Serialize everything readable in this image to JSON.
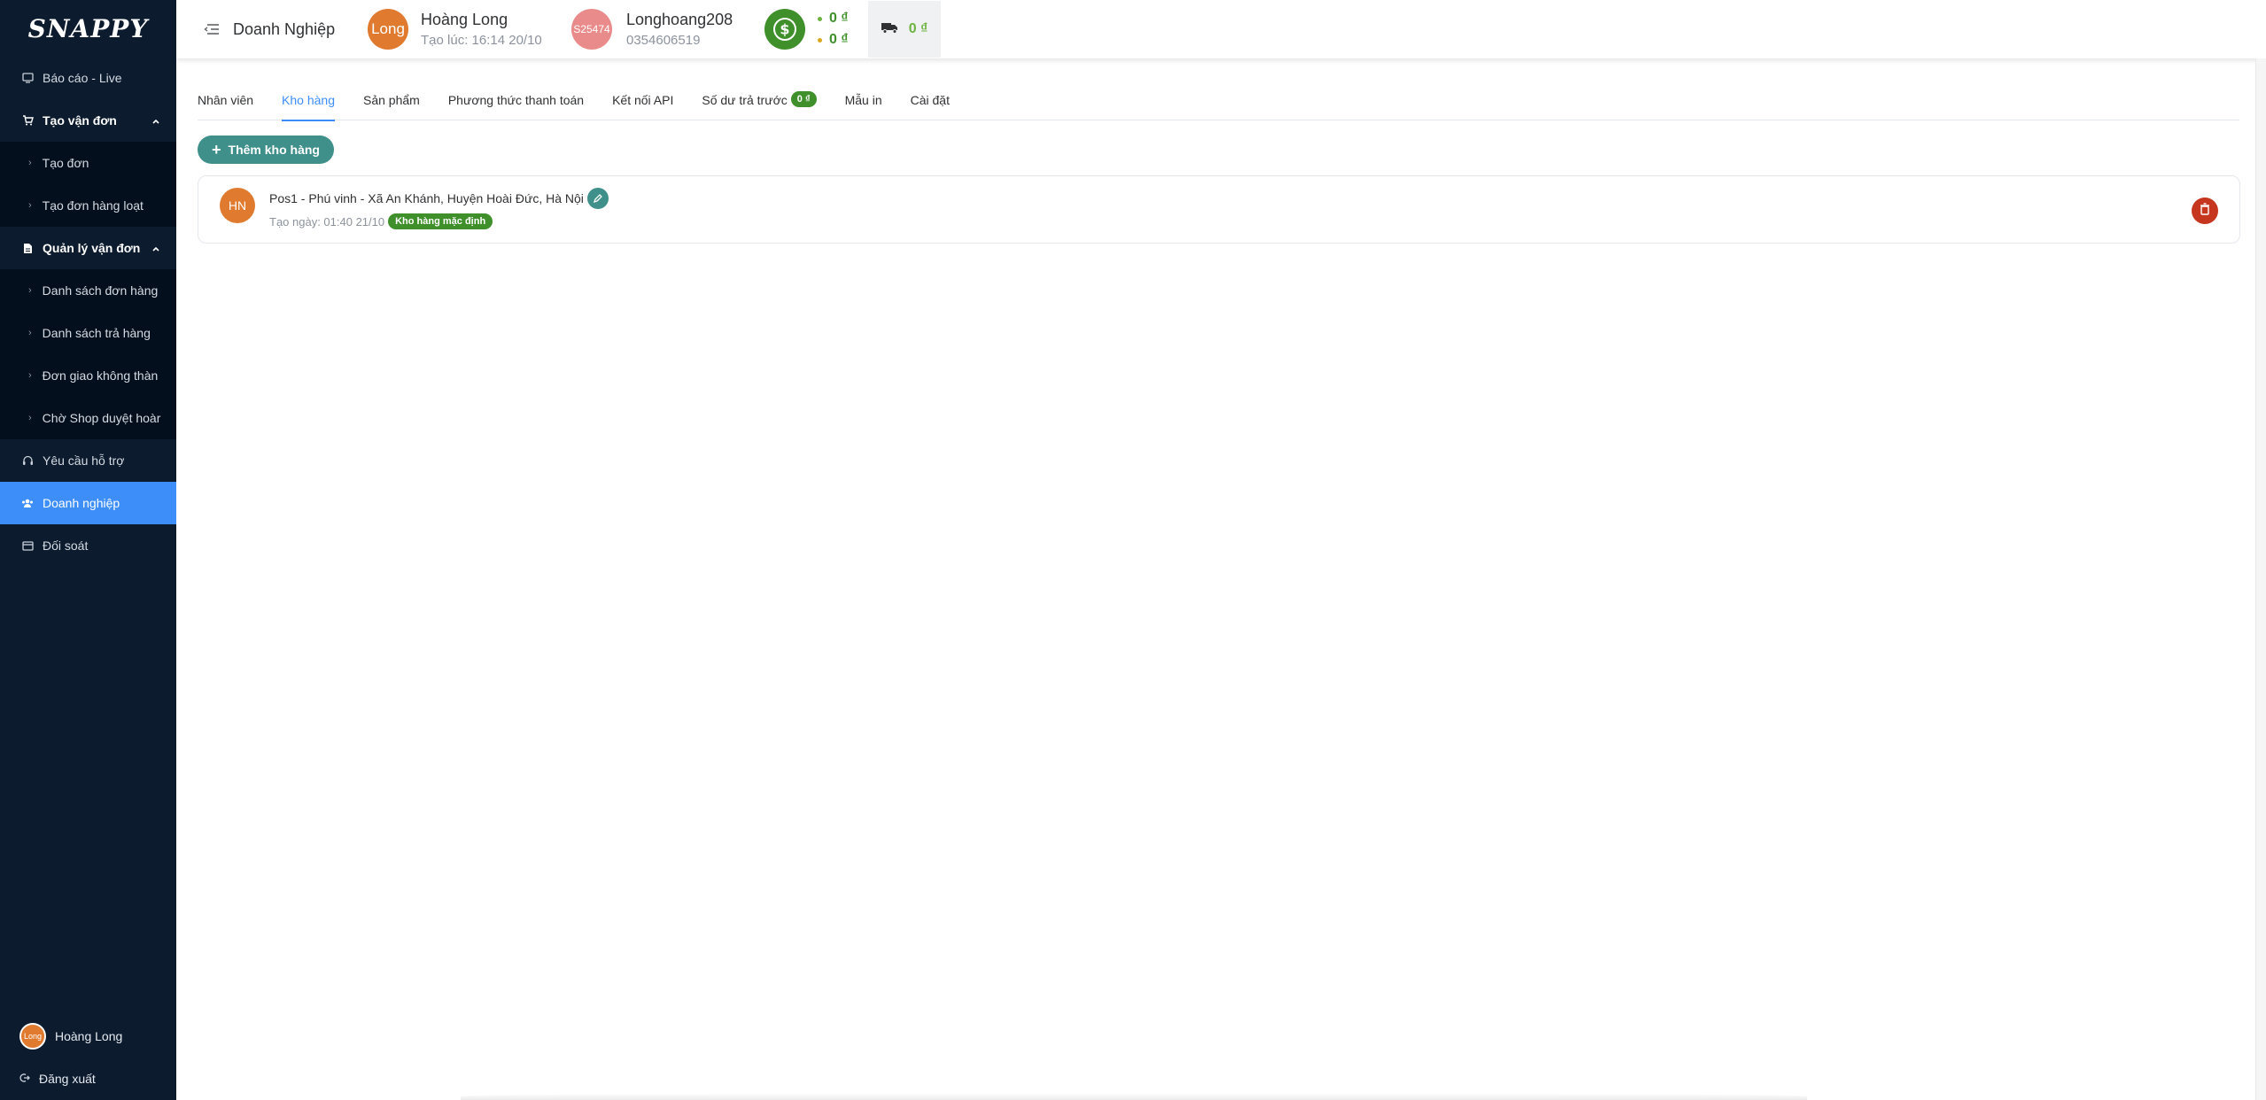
{
  "app": {
    "logo_text": "SNAPPY"
  },
  "sidebar": {
    "items": [
      {
        "label": "Báo cáo - Live",
        "icon": "monitor-icon"
      },
      {
        "label": "Tạo vận đơn",
        "icon": "cart-icon",
        "group": true
      },
      {
        "label": "Tạo đơn",
        "sub": true
      },
      {
        "label": "Tạo đơn hàng loạt",
        "sub": true
      },
      {
        "label": "Quản lý vận đơn",
        "icon": "document-icon",
        "group": true
      },
      {
        "label": "Danh sách đơn hàng",
        "sub": true
      },
      {
        "label": "Danh sách trả hàng",
        "sub": true
      },
      {
        "label": "Đơn giao không thàn",
        "sub": true
      },
      {
        "label": "Chờ Shop duyệt hoàr",
        "sub": true
      },
      {
        "label": "Yêu cầu hỗ trợ",
        "icon": "headset-icon"
      },
      {
        "label": "Doanh nghiệp",
        "icon": "users-icon",
        "active": true
      },
      {
        "label": "Đối soát",
        "icon": "card-icon"
      }
    ],
    "footer": {
      "user_name": "Hoàng Long",
      "avatar_text": "Long",
      "logout_label": "Đăng xuất"
    }
  },
  "header": {
    "title": "Doanh Nghiệp",
    "user": {
      "avatar_text": "Long",
      "name": "Hoàng Long",
      "created": "Tạo lúc: 16:14 20/10"
    },
    "shop": {
      "avatar_text": "S25474",
      "name": "Longhoang208",
      "phone": "0354606519"
    },
    "balances": [
      "0 ₫",
      "0 ₫"
    ],
    "shipping_balance": "0 ₫"
  },
  "tabs": [
    {
      "label": "Nhân viên"
    },
    {
      "label": "Kho hàng",
      "active": true
    },
    {
      "label": "Sản phẩm"
    },
    {
      "label": "Phương thức thanh toán"
    },
    {
      "label": "Kết nối API"
    },
    {
      "label": "Số dư trả trước",
      "badge": "0 ₫"
    },
    {
      "label": "Mẫu in"
    },
    {
      "label": "Cài đặt"
    }
  ],
  "actions": {
    "add_warehouse": "Thêm kho hàng"
  },
  "warehouses": [
    {
      "avatar_text": "HN",
      "address": "Pos1 - Phú vinh - Xã An Khánh, Huyện Hoài Đức, Hà Nội",
      "created": "Tạo ngày: 01:40 21/10",
      "badge": "Kho hàng mặc định"
    }
  ],
  "colors": {
    "sidebar_bg": "#0c1b2e",
    "active_blue": "#3d8ef8",
    "green": "#3f8f2a",
    "teal": "#3f8f8a",
    "danger": "#c6361f",
    "orange": "#e07a2f"
  }
}
